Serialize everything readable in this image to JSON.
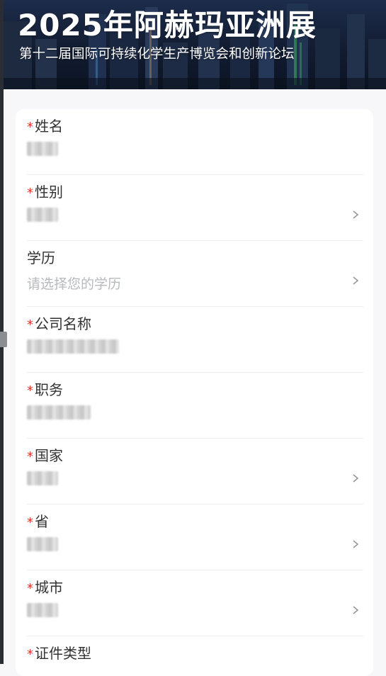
{
  "banner": {
    "title": "2025年阿赫玛亚洲展",
    "subtitle": "第十二届国际可持续化学生产博览会和创新论坛"
  },
  "form": {
    "required_mark": "*",
    "fields": [
      {
        "label": "姓名",
        "required": true,
        "value": "",
        "redacted": true,
        "has_chevron": false
      },
      {
        "label": "性别",
        "required": true,
        "value": "",
        "redacted": true,
        "has_chevron": true
      },
      {
        "label": "学历",
        "required": false,
        "value": "",
        "placeholder": "请选择您的学历",
        "redacted": false,
        "has_chevron": true
      },
      {
        "label": "公司名称",
        "required": true,
        "value": "",
        "redacted": true,
        "has_chevron": false
      },
      {
        "label": "职务",
        "required": true,
        "value": "",
        "redacted": true,
        "has_chevron": false
      },
      {
        "label": "国家",
        "required": true,
        "value": "",
        "redacted": true,
        "has_chevron": true
      },
      {
        "label": "省",
        "required": true,
        "value": "",
        "redacted": true,
        "has_chevron": true
      },
      {
        "label": "城市",
        "required": true,
        "value": "",
        "redacted": true,
        "has_chevron": true
      },
      {
        "label": "证件类型",
        "required": true,
        "value": "",
        "redacted": false,
        "has_chevron": false
      }
    ]
  },
  "colors": {
    "required": "#e5322d",
    "label": "#323233",
    "placeholder": "#b8b9bc",
    "chevron": "#969799",
    "banner_bg": "#121c31"
  },
  "icons": {
    "chevron": "chevron-right-icon"
  }
}
